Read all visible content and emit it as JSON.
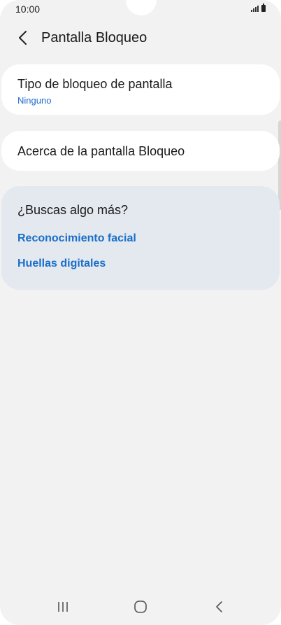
{
  "status_bar": {
    "time": "10:00",
    "icons": [
      "signal-icon",
      "battery-icon"
    ]
  },
  "header": {
    "back_icon": "chevron-left-icon",
    "title": "Pantalla Bloqueo"
  },
  "lock_type": {
    "title": "Tipo de bloqueo de pantalla",
    "value": "Ninguno"
  },
  "about": {
    "title": "Acerca de la pantalla Bloqueo"
  },
  "suggestions": {
    "title": "¿Buscas algo más?",
    "links": [
      "Reconocimiento facial",
      "Huellas digitales"
    ]
  },
  "nav_bar": {
    "icons": [
      "recents-icon",
      "home-icon",
      "back-icon"
    ]
  },
  "colors": {
    "background": "#f2f2f2",
    "card": "#ffffff",
    "suggestion_card": "#e4e8ef",
    "accent": "#1a6fc9"
  }
}
